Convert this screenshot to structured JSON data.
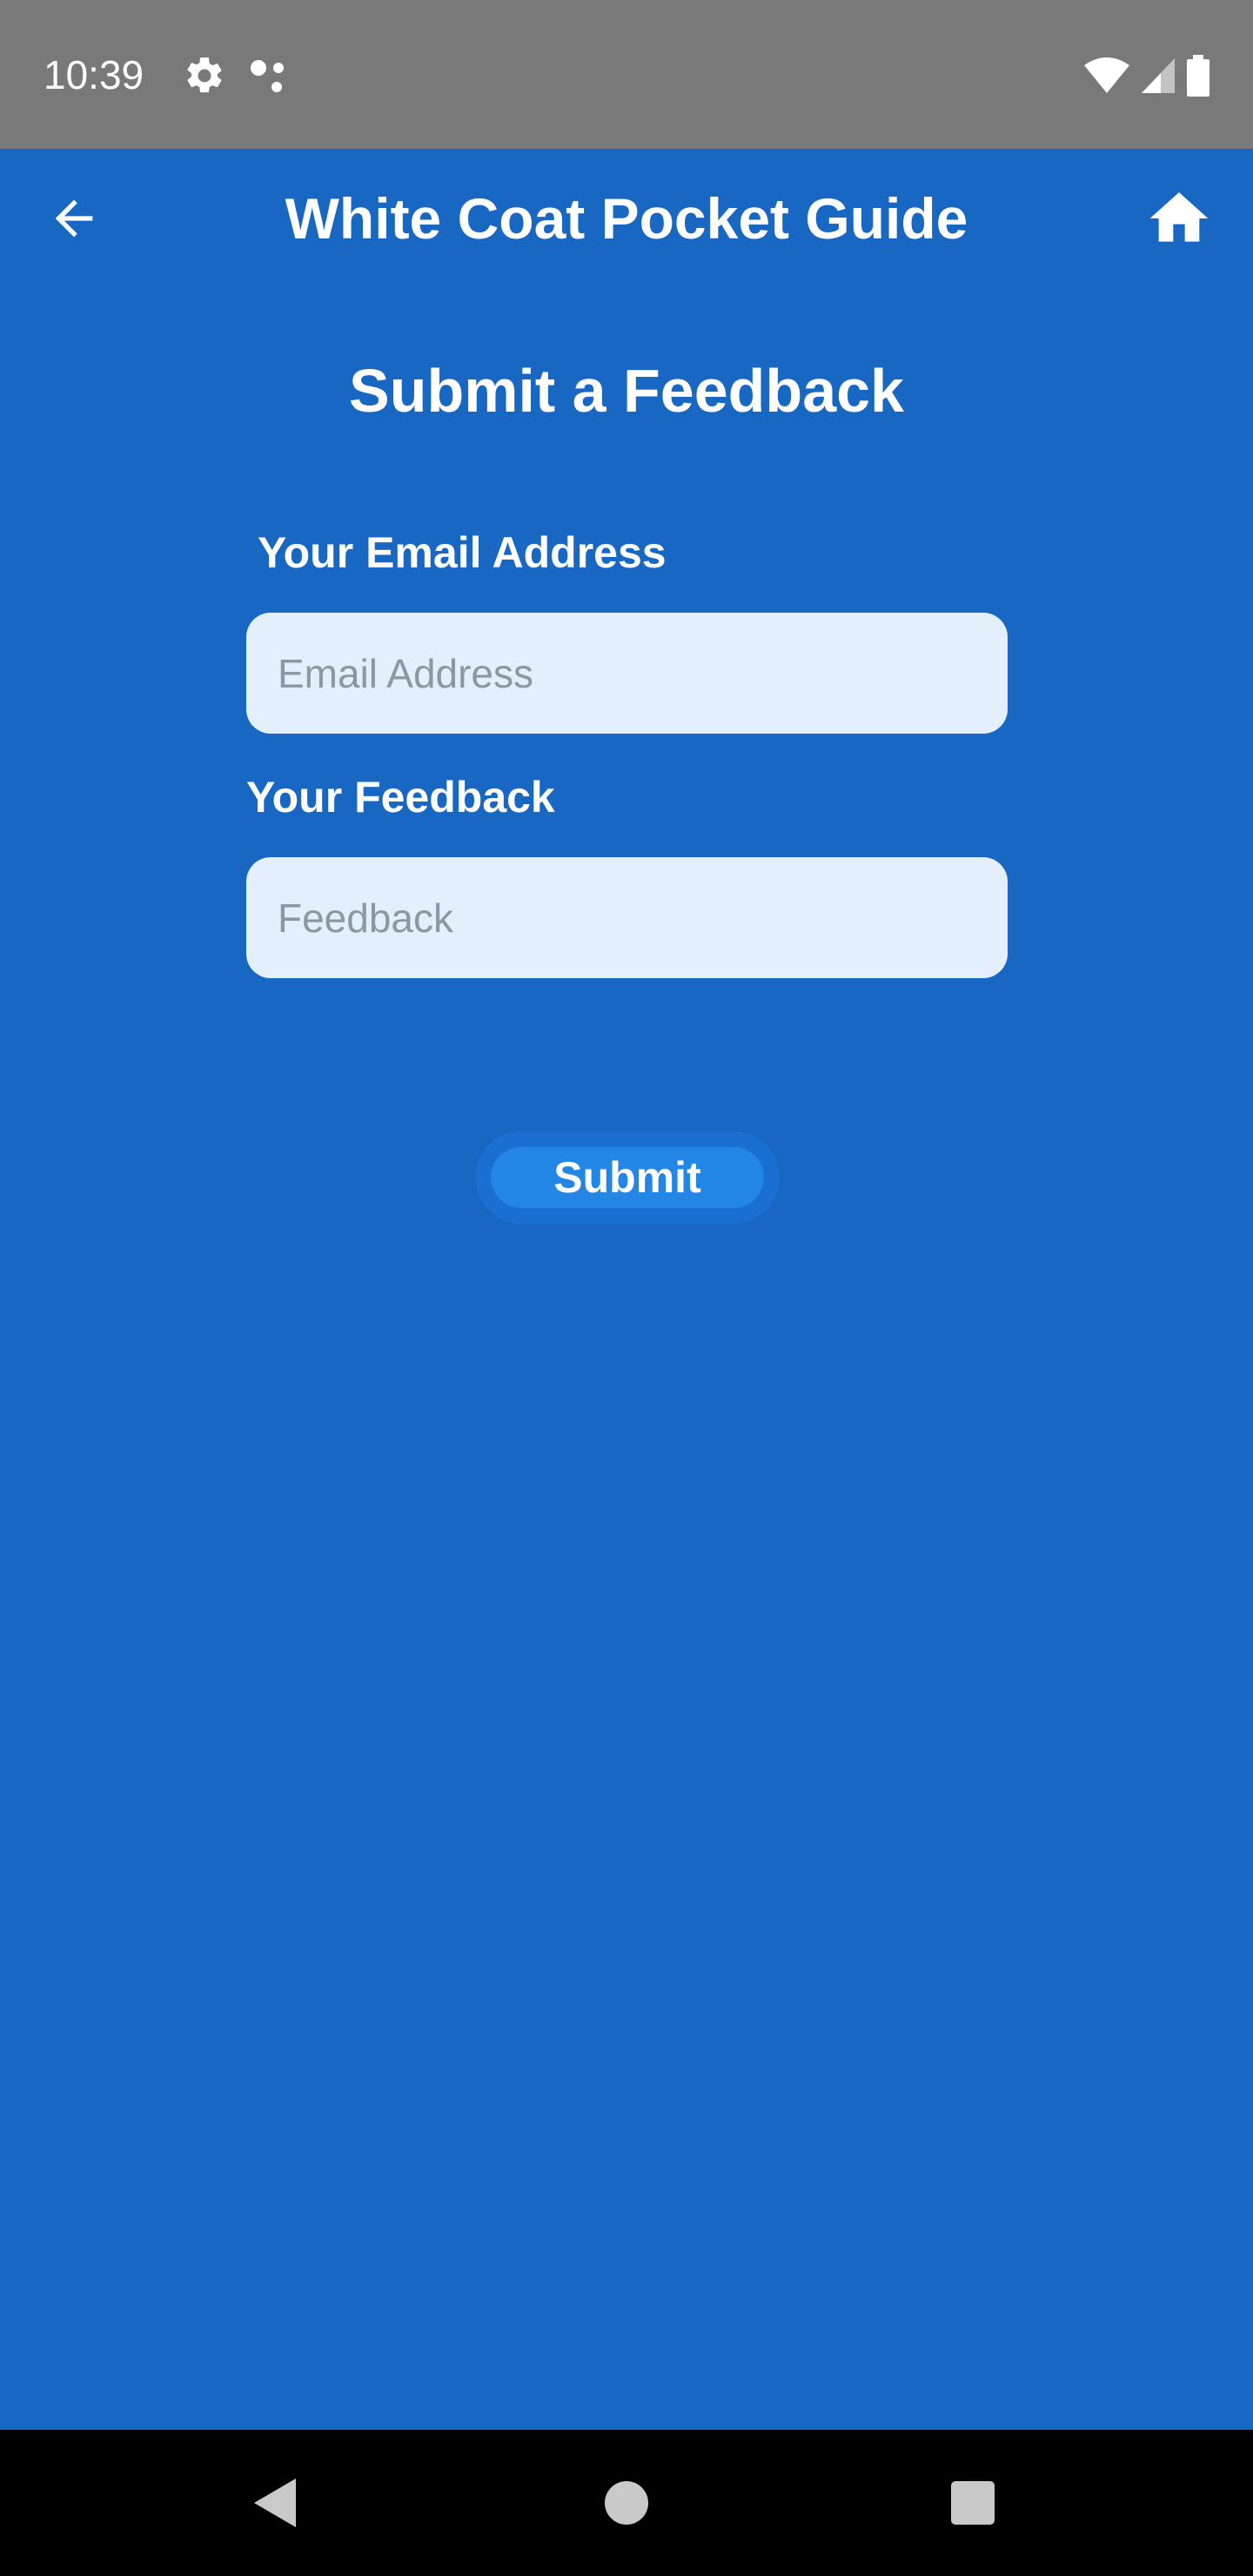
{
  "status_bar": {
    "time": "10:39",
    "icons": [
      "gear-icon",
      "assistant-dots-icon",
      "wifi-icon",
      "cell-signal-icon",
      "battery-icon"
    ]
  },
  "app_bar": {
    "title": "White Coat Pocket Guide",
    "back_icon": "arrow-left-icon",
    "home_icon": "home-icon"
  },
  "form": {
    "title": "Submit a Feedback",
    "email_label": "Your Email Address",
    "email_placeholder": "Email Address",
    "email_value": "",
    "feedback_label": "Your Feedback",
    "feedback_placeholder": "Feedback",
    "feedback_value": "",
    "submit_label": "Submit"
  },
  "nav_bar": {
    "icons": [
      "nav-back-icon",
      "nav-home-icon",
      "nav-recents-icon"
    ]
  },
  "colors": {
    "background": "#1767C3",
    "status_bar": "#797979",
    "input_fill": "#E3F0FC",
    "button": "#2385E4",
    "nav_bar": "#000000"
  }
}
